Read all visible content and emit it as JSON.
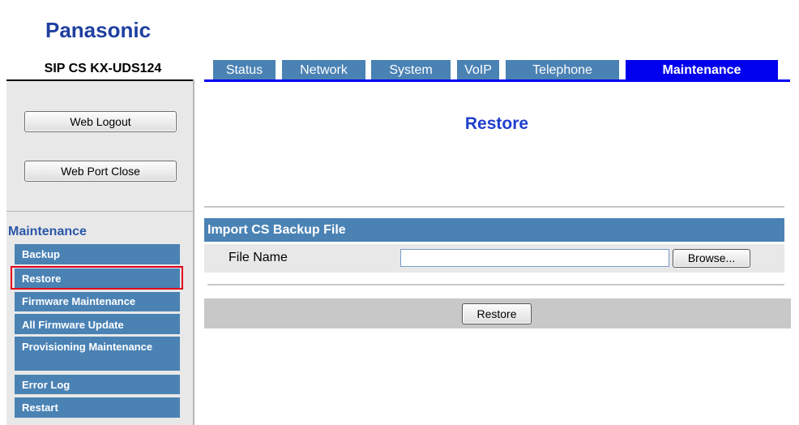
{
  "header": {
    "brand": "Panasonic",
    "device_name": "SIP CS KX-UDS124"
  },
  "tabs": [
    {
      "label": "Status"
    },
    {
      "label": "Network"
    },
    {
      "label": "System"
    },
    {
      "label": "VoIP"
    },
    {
      "label": "Telephone"
    },
    {
      "label": "Maintenance",
      "active": true
    }
  ],
  "sidebar": {
    "web_logout_label": "Web Logout",
    "web_port_close_label": "Web Port Close",
    "menu_title": "Maintenance",
    "items": [
      {
        "label": "Backup"
      },
      {
        "label": "Restore",
        "selected": true
      },
      {
        "label": "Firmware Maintenance"
      },
      {
        "label": "All Firmware Update"
      },
      {
        "label": "Provisioning Maintenance"
      },
      {
        "label": "Error Log"
      },
      {
        "label": "Restart"
      }
    ]
  },
  "main": {
    "title": "Restore",
    "section_title": "Import CS Backup File",
    "file_name_label": "File Name",
    "file_name_value": "",
    "browse_label": "Browse...",
    "restore_button_label": "Restore"
  },
  "colors": {
    "brand": "#1f3fa0",
    "tab_bg": "#4a82b4",
    "tab_active": "#0000ee",
    "highlight": "#e0001a"
  }
}
